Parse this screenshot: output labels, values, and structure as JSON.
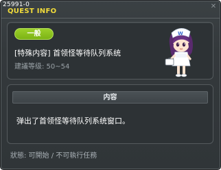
{
  "window": {
    "quest_id": "25991-0",
    "title": "QUEST INFO"
  },
  "info": {
    "category": "一般",
    "quest_name": "[特殊内容] 首领怪等待队列系统",
    "level_label": "建議等级: 50~54",
    "npc_icon": "npc-nurse-avatar"
  },
  "content": {
    "header": "内容",
    "text": "弹出了首领怪等待队列系统窗口。"
  },
  "status": {
    "text": "狀態: 可開始 / 不可執行任務"
  },
  "colors": {
    "title_yellow": "#f2dc3a",
    "badge_green": "#8cc21f",
    "window_bg": "#34393c"
  }
}
